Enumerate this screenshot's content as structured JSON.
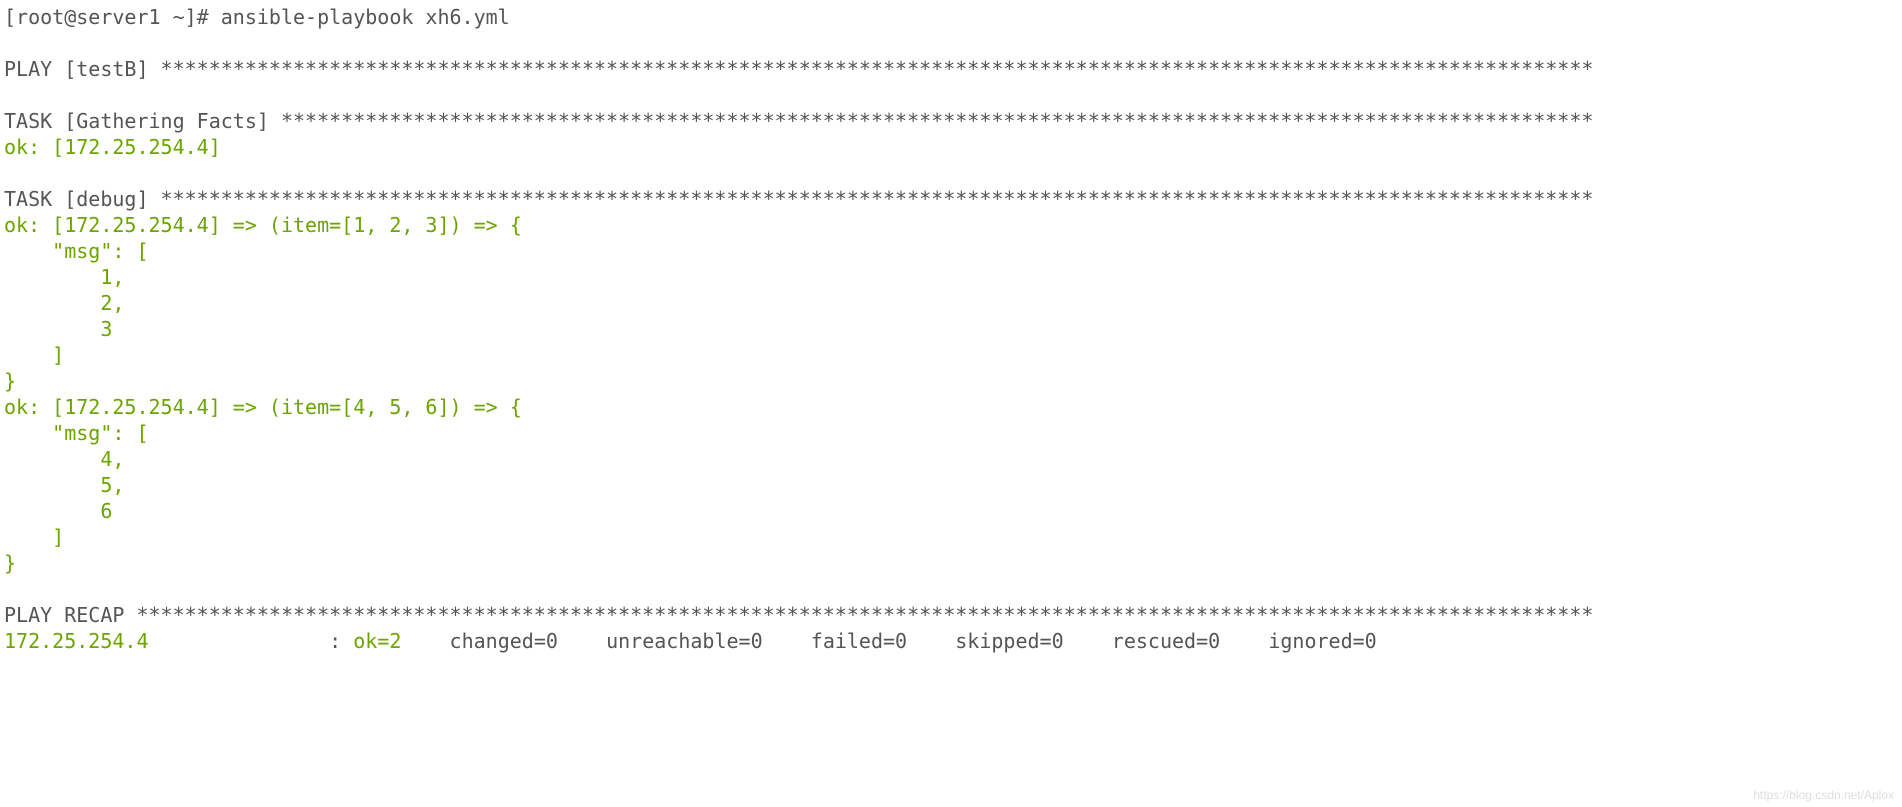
{
  "prompt": "[root@server1 ~]# ansible-playbook xh6.yml",
  "blank1": "",
  "play_header": "PLAY [testB] ***********************************************************************************************************************",
  "blank2": "",
  "task1_header": "TASK [Gathering Facts] *************************************************************************************************************",
  "task1_ok": "ok: [172.25.254.4]",
  "blank3": "",
  "task2_header": "TASK [debug] ***********************************************************************************************************************",
  "item1_line1": "ok: [172.25.254.4] => (item=[1, 2, 3]) => {",
  "item1_line2": "    \"msg\": [",
  "item1_line3": "        1,",
  "item1_line4": "        2,",
  "item1_line5": "        3",
  "item1_line6": "    ]",
  "item1_line7": "}",
  "item2_line1": "ok: [172.25.254.4] => (item=[4, 5, 6]) => {",
  "item2_line2": "    \"msg\": [",
  "item2_line3": "        4,",
  "item2_line4": "        5,",
  "item2_line5": "        6",
  "item2_line6": "    ]",
  "item2_line7": "}",
  "blank4": "",
  "recap_header": "PLAY RECAP *************************************************************************************************************************",
  "recap_host": "172.25.254.4",
  "recap_colon": "               : ",
  "recap_ok": "ok=2   ",
  "recap_rest": " changed=0    unreachable=0    failed=0    skipped=0    rescued=0    ignored=0   ",
  "watermark": "https://blog.csdn.net/Aplox"
}
